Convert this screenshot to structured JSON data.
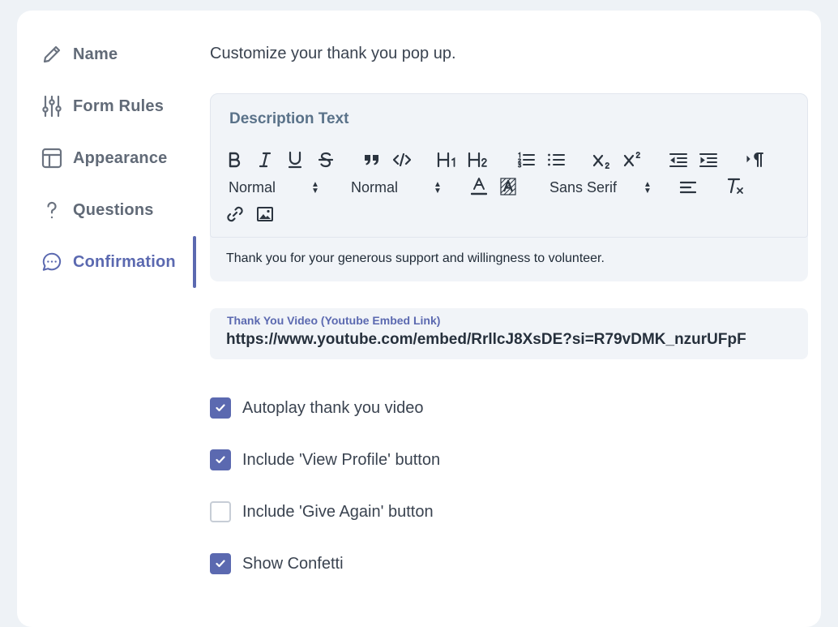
{
  "sidebar": {
    "items": [
      {
        "label": "Name",
        "icon": "pencil-icon",
        "active": false
      },
      {
        "label": "Form Rules",
        "icon": "sliders-icon",
        "active": false
      },
      {
        "label": "Appearance",
        "icon": "layout-icon",
        "active": false
      },
      {
        "label": "Questions",
        "icon": "question-icon",
        "active": false
      },
      {
        "label": "Confirmation",
        "icon": "chat-icon",
        "active": true
      }
    ]
  },
  "main": {
    "intro": "Customize your thank you pop up.",
    "editor": {
      "title": "Description Text",
      "header_select": "Normal",
      "size_select": "Normal",
      "font_select": "Sans Serif",
      "content": "Thank you for your generous support and willingness to volunteer."
    },
    "video": {
      "label": "Thank You Video (Youtube Embed Link)",
      "value": "https://www.youtube.com/embed/RrllcJ8XsDE?si=R79vDMK_nzurUFpF"
    },
    "options": [
      {
        "label": "Autoplay thank you video",
        "checked": true
      },
      {
        "label": "Include 'View Profile' button",
        "checked": true
      },
      {
        "label": "Include 'Give Again' button",
        "checked": false
      },
      {
        "label": "Show Confetti",
        "checked": true
      }
    ]
  },
  "colors": {
    "accent": "#5b69b0",
    "background": "#eef2f6",
    "field_bg": "#f1f4f8"
  }
}
